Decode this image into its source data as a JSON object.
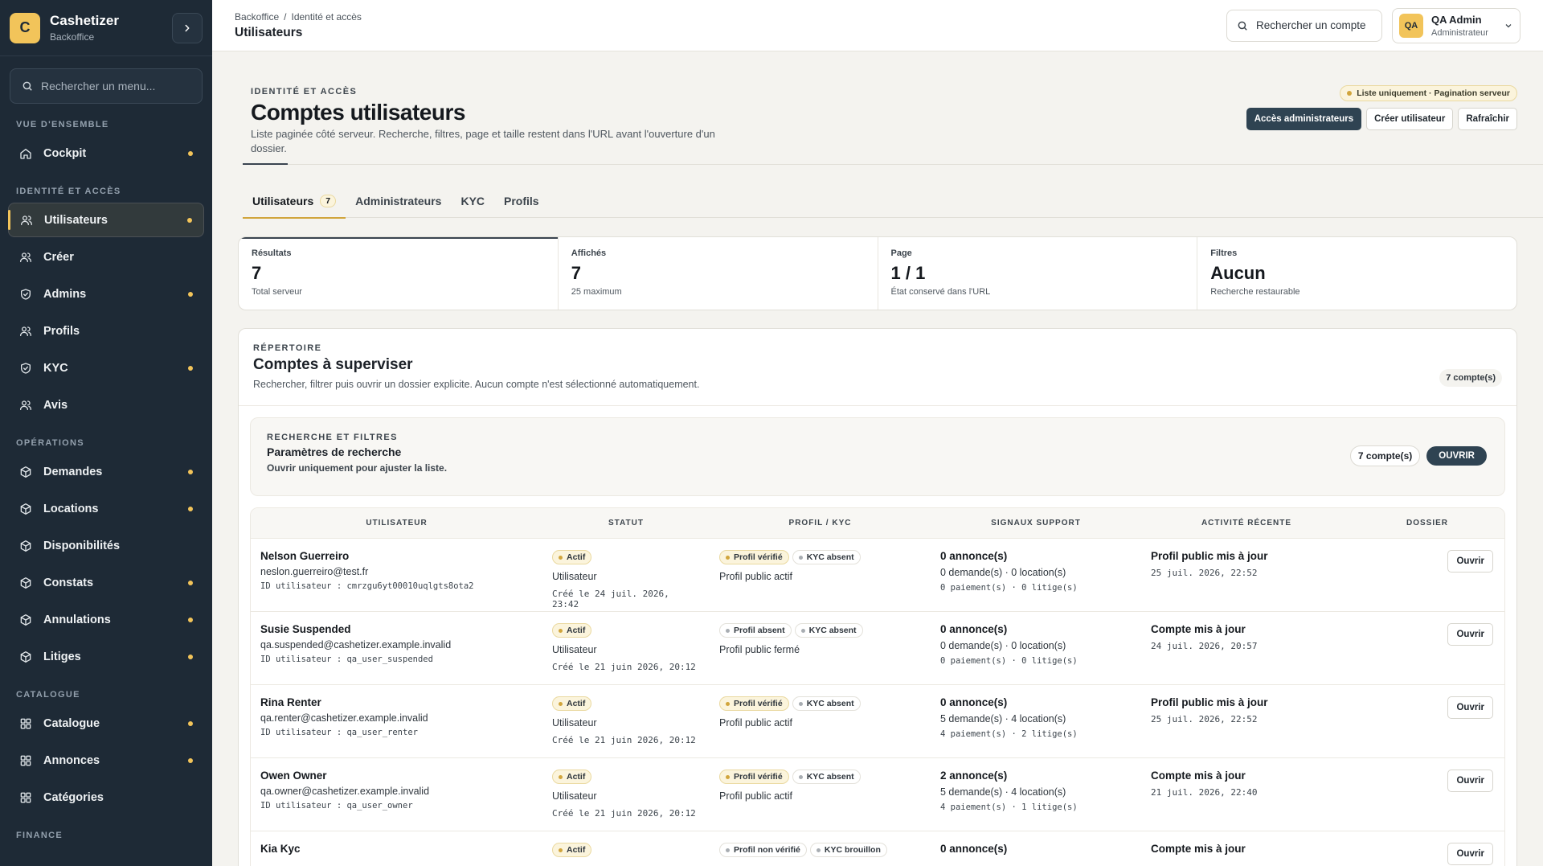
{
  "brand": {
    "logo": "C",
    "name": "Cashetizer",
    "sub": "Backoffice"
  },
  "sidebar": {
    "search_placeholder": "Rechercher un menu...",
    "sections": [
      {
        "title": "VUE D'ENSEMBLE",
        "items": [
          {
            "label": "Cockpit",
            "icon": "home-icon",
            "dot": true
          }
        ]
      },
      {
        "title": "IDENTITÉ ET ACCÈS",
        "items": [
          {
            "label": "Utilisateurs",
            "icon": "users-icon",
            "dot": true,
            "active": true
          },
          {
            "label": "Créer",
            "icon": "users-icon",
            "dot": false
          },
          {
            "label": "Admins",
            "icon": "shield-icon",
            "dot": true
          },
          {
            "label": "Profils",
            "icon": "users-icon",
            "dot": false
          },
          {
            "label": "KYC",
            "icon": "shield-icon",
            "dot": true
          },
          {
            "label": "Avis",
            "icon": "users-icon",
            "dot": false
          }
        ]
      },
      {
        "title": "OPÉRATIONS",
        "items": [
          {
            "label": "Demandes",
            "icon": "box-icon",
            "dot": true
          },
          {
            "label": "Locations",
            "icon": "box-icon",
            "dot": true
          },
          {
            "label": "Disponibilités",
            "icon": "box-icon",
            "dot": false
          },
          {
            "label": "Constats",
            "icon": "box-icon",
            "dot": true
          },
          {
            "label": "Annulations",
            "icon": "box-icon",
            "dot": true
          },
          {
            "label": "Litiges",
            "icon": "box-icon",
            "dot": true
          }
        ]
      },
      {
        "title": "CATALOGUE",
        "items": [
          {
            "label": "Catalogue",
            "icon": "grid-icon",
            "dot": true
          },
          {
            "label": "Annonces",
            "icon": "grid-icon",
            "dot": true
          },
          {
            "label": "Catégories",
            "icon": "grid-icon",
            "dot": false
          }
        ]
      },
      {
        "title": "FINANCE",
        "items": []
      }
    ]
  },
  "topbar": {
    "breadcrumb": [
      "Backoffice",
      "/",
      "Identité et accès"
    ],
    "title": "Utilisateurs",
    "search_label": "Rechercher un compte",
    "account": {
      "initials": "QA",
      "name": "QA Admin",
      "role": "Administrateur"
    }
  },
  "header": {
    "eyebrow": "IDENTITÉ ET ACCÈS",
    "title": "Comptes utilisateurs",
    "description": "Liste paginée côté serveur. Recherche, filtres, page et taille restent dans l'URL avant l'ouverture d'un dossier.",
    "note": "Liste uniquement · Pagination serveur",
    "actions": [
      "Accès administrateurs",
      "Créer utilisateur",
      "Rafraîchir"
    ]
  },
  "tabs": [
    {
      "label": "Utilisateurs",
      "count": "7",
      "active": true
    },
    {
      "label": "Administrateurs"
    },
    {
      "label": "KYC"
    },
    {
      "label": "Profils"
    }
  ],
  "stats": [
    {
      "label": "Résultats",
      "value": "7",
      "sub": "Total serveur"
    },
    {
      "label": "Affichés",
      "value": "7",
      "sub": "25 maximum"
    },
    {
      "label": "Page",
      "value": "1 / 1",
      "sub": "État conservé dans l'URL"
    },
    {
      "label": "Filtres",
      "value": "Aucun",
      "sub": "Recherche restaurable"
    }
  ],
  "directory": {
    "eyebrow": "RÉPERTOIRE",
    "title": "Comptes à superviser",
    "description": "Rechercher, filtrer puis ouvrir un dossier explicite. Aucun compte n'est sélectionné automatiquement.",
    "count": "7 compte(s)",
    "filters": {
      "eyebrow": "RECHERCHE ET FILTRES",
      "title": "Paramètres de recherche",
      "sub": "Ouvrir uniquement pour ajuster la liste.",
      "count": "7 compte(s)",
      "open_label": "OUVRIR"
    },
    "columns": [
      "UTILISATEUR",
      "STATUT",
      "PROFIL / KYC",
      "SIGNAUX SUPPORT",
      "ACTIVITÉ RÉCENTE",
      "DOSSIER"
    ],
    "open_label": "Ouvrir",
    "rows": [
      {
        "name": "Nelson Guerreiro",
        "email": "neslon.guerreiro@test.fr",
        "id": "ID utilisateur : cmrzgu6yt00010uqlgts8ota2",
        "status": "Actif",
        "role": "Utilisateur",
        "created": "Créé le 24 juil. 2026, 23:42",
        "badges": [
          {
            "label": "Profil vérifié",
            "gold": true
          },
          {
            "label": "KYC absent",
            "gold": false
          }
        ],
        "profile": "Profil public actif",
        "sig_main": "0 annonce(s)",
        "sig_line": "0 demande(s) · 0 location(s)",
        "sig_sub": "0 paiement(s) · 0 litige(s)",
        "activity": "Profil public mis à jour",
        "activity_date": "25 juil. 2026, 22:52"
      },
      {
        "name": "Susie Suspended",
        "email": "qa.suspended@cashetizer.example.invalid",
        "id": "ID utilisateur : qa_user_suspended",
        "status": "Actif",
        "role": "Utilisateur",
        "created": "Créé le 21 juin 2026, 20:12",
        "badges": [
          {
            "label": "Profil absent",
            "gold": false
          },
          {
            "label": "KYC absent",
            "gold": false
          }
        ],
        "profile": "Profil public fermé",
        "sig_main": "0 annonce(s)",
        "sig_line": "0 demande(s) · 0 location(s)",
        "sig_sub": "0 paiement(s) · 0 litige(s)",
        "activity": "Compte mis à jour",
        "activity_date": "24 juil. 2026, 20:57"
      },
      {
        "name": "Rina Renter",
        "email": "qa.renter@cashetizer.example.invalid",
        "id": "ID utilisateur : qa_user_renter",
        "status": "Actif",
        "role": "Utilisateur",
        "created": "Créé le 21 juin 2026, 20:12",
        "badges": [
          {
            "label": "Profil vérifié",
            "gold": true
          },
          {
            "label": "KYC absent",
            "gold": false
          }
        ],
        "profile": "Profil public actif",
        "sig_main": "0 annonce(s)",
        "sig_line": "5 demande(s) · 4 location(s)",
        "sig_sub": "4 paiement(s) · 2 litige(s)",
        "activity": "Profil public mis à jour",
        "activity_date": "25 juil. 2026, 22:52"
      },
      {
        "name": "Owen Owner",
        "email": "qa.owner@cashetizer.example.invalid",
        "id": "ID utilisateur : qa_user_owner",
        "status": "Actif",
        "role": "Utilisateur",
        "created": "Créé le 21 juin 2026, 20:12",
        "badges": [
          {
            "label": "Profil vérifié",
            "gold": true
          },
          {
            "label": "KYC absent",
            "gold": false
          }
        ],
        "profile": "Profil public actif",
        "sig_main": "2 annonce(s)",
        "sig_line": "5 demande(s) · 4 location(s)",
        "sig_sub": "4 paiement(s) · 1 litige(s)",
        "activity": "Compte mis à jour",
        "activity_date": "21 juil. 2026, 22:40"
      },
      {
        "name": "Kia Kyc",
        "email": "",
        "id": "",
        "status": "Actif",
        "role": "",
        "created": "",
        "badges": [
          {
            "label": "Profil non vérifié",
            "gold": false
          },
          {
            "label": "KYC brouillon",
            "gold": false
          }
        ],
        "profile": "",
        "sig_main": "0 annonce(s)",
        "sig_line": "",
        "sig_sub": "",
        "activity": "Compte mis à jour",
        "activity_date": ""
      }
    ]
  },
  "colors": {
    "sidebar_bg": "#1e2a36",
    "accent": "#f2c45a",
    "primary_button": "#2f4352",
    "page_bg": "#f4f3ef"
  }
}
